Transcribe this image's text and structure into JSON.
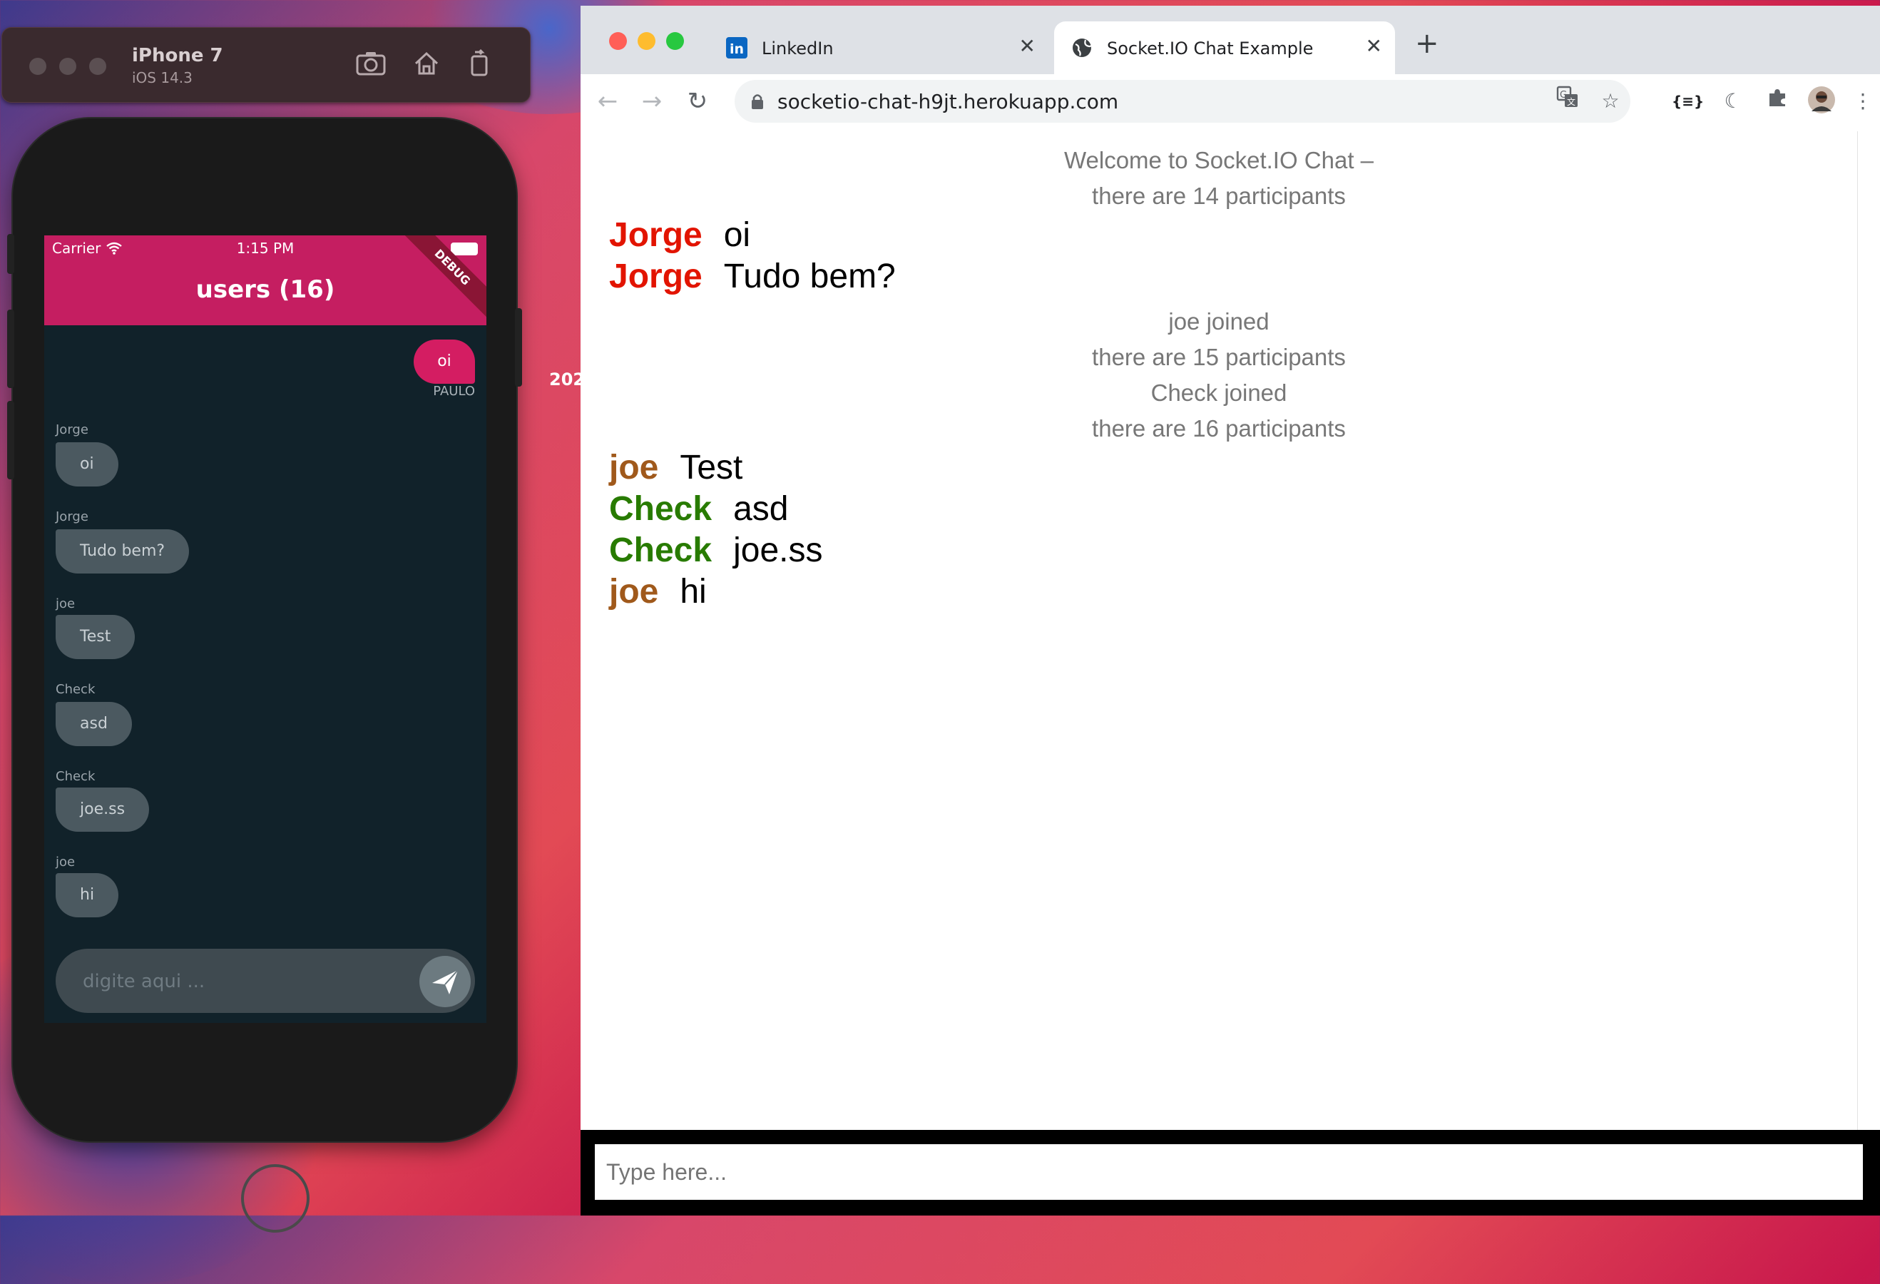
{
  "desktop": {
    "label": "202"
  },
  "simulator": {
    "title": "iPhone 7",
    "subtitle": "iOS 14.3"
  },
  "phone": {
    "status": {
      "carrier": "Carrier",
      "time": "1:15 PM"
    },
    "app_title": "users (16)",
    "debug_banner": "DEBUG",
    "my_message": {
      "text": "oi",
      "author": "PAULO"
    },
    "messages": [
      {
        "author": "Jorge",
        "text": "oi"
      },
      {
        "author": "Jorge",
        "text": "Tudo bem?"
      },
      {
        "author": "joe",
        "text": "Test"
      },
      {
        "author": "Check",
        "text": "asd"
      },
      {
        "author": "Check",
        "text": "joe.ss"
      },
      {
        "author": "joe",
        "text": "hi"
      }
    ],
    "input_placeholder": "digite aqui ..."
  },
  "browser": {
    "tabs": [
      {
        "label": "LinkedIn",
        "active": false
      },
      {
        "label": "Socket.IO Chat Example",
        "active": true
      }
    ],
    "url": "socketio-chat-h9jt.herokuapp.com",
    "log": [
      "Welcome to Socket.IO Chat –",
      "there are 14 participants",
      "joe joined",
      "there are 15 participants",
      "Check joined",
      "there are 16 participants"
    ],
    "chat": [
      {
        "user": "Jorge",
        "text": "oi",
        "color": "#e21400"
      },
      {
        "user": "Jorge",
        "text": "Tudo bem?",
        "color": "#e21400"
      },
      {
        "user": "joe",
        "text": "Test",
        "color": "#a0591b"
      },
      {
        "user": "Check",
        "text": "asd",
        "color": "#287b00"
      },
      {
        "user": "Check",
        "text": "joe.ss",
        "color": "#287b00"
      },
      {
        "user": "joe",
        "text": "hi",
        "color": "#a0591b"
      }
    ],
    "input_placeholder": "Type here..."
  },
  "colors": {
    "accent": "#c51e61",
    "phone_bg": "#11222a",
    "linkedin": "#0a66c2"
  }
}
